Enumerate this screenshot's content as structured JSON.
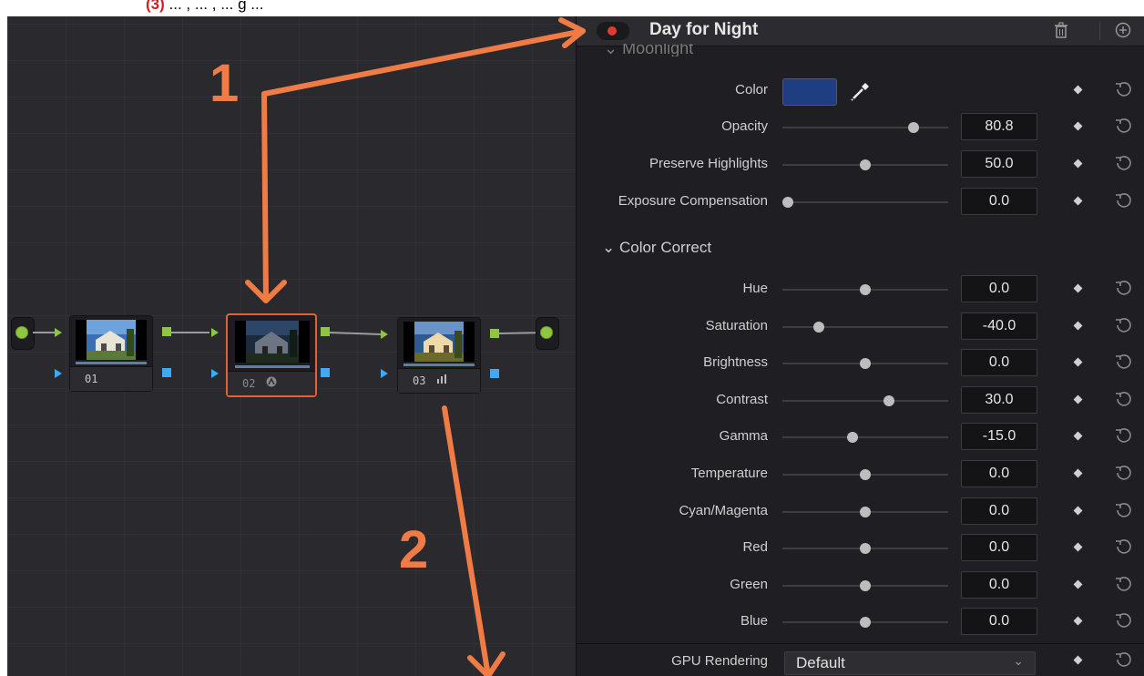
{
  "caption": {
    "red_marker": "(3)",
    "text": "... , ... , ... g ..."
  },
  "node_editor": {
    "nodes": [
      {
        "label": "01",
        "icon": ""
      },
      {
        "label": "02",
        "icon": "fx-icon"
      },
      {
        "label": "03",
        "icon": "chart-icon"
      }
    ]
  },
  "inspector": {
    "title": "Day for Night",
    "enabled": true,
    "section_moonlight": "Moonlight",
    "color_label": "Color",
    "moonlight_color": "#1f3e82",
    "moonlight_rows": [
      {
        "label": "Opacity",
        "value": "80.8",
        "fraction": 0.81
      },
      {
        "label": "Preserve Highlights",
        "value": "50.0",
        "fraction": 0.5
      },
      {
        "label": "Exposure Compensation",
        "value": "0.0",
        "fraction": 0.0
      }
    ],
    "section_colorcorrect": "Color Correct",
    "colorcorrect_rows": [
      {
        "label": "Hue",
        "value": "0.0",
        "fraction": 0.5
      },
      {
        "label": "Saturation",
        "value": "-40.0",
        "fraction": 0.2
      },
      {
        "label": "Brightness",
        "value": "0.0",
        "fraction": 0.5
      },
      {
        "label": "Contrast",
        "value": "30.0",
        "fraction": 0.65
      },
      {
        "label": "Gamma",
        "value": "-15.0",
        "fraction": 0.42
      },
      {
        "label": "Temperature",
        "value": "0.0",
        "fraction": 0.5
      },
      {
        "label": "Cyan/Magenta",
        "value": "0.0",
        "fraction": 0.5
      },
      {
        "label": "Red",
        "value": "0.0",
        "fraction": 0.5
      },
      {
        "label": "Green",
        "value": "0.0",
        "fraction": 0.5
      },
      {
        "label": "Blue",
        "value": "0.0",
        "fraction": 0.5
      }
    ],
    "gpu_label": "GPU Rendering",
    "gpu_value": "Default"
  },
  "annotations": {
    "label_1": "1",
    "label_2": "2",
    "arrow_color": "#f07b45"
  },
  "colors": {
    "accent_red": "#e23a30",
    "port_green": "#8ec63f",
    "port_blue": "#3fa9f5",
    "selected_border": "#e1623a"
  }
}
